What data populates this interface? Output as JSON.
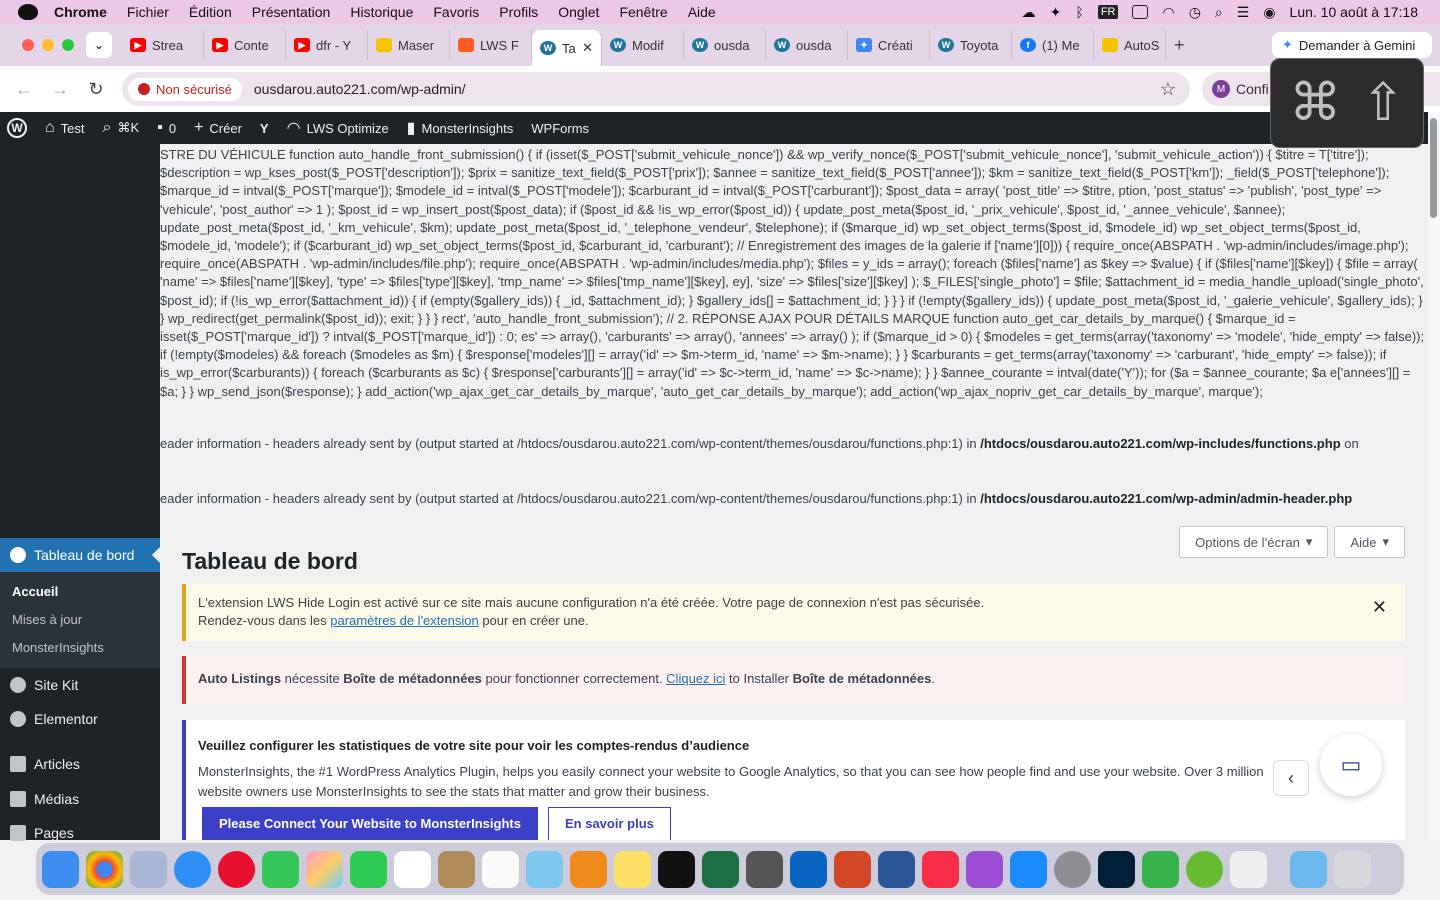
{
  "mac_menu": {
    "app": "Chrome",
    "items": [
      "Fichier",
      "Édition",
      "Présentation",
      "Historique",
      "Favoris",
      "Profils",
      "Onglet",
      "Fenêtre",
      "Aide"
    ],
    "datetime": "Lun. 10 août à 17:18",
    "kbd": "FR"
  },
  "tabs": [
    {
      "label": "Strea",
      "icon": "youtube",
      "color": "#ff0000"
    },
    {
      "label": "Conte",
      "icon": "youtube",
      "color": "#ff0000"
    },
    {
      "label": "dfr - Y",
      "icon": "youtube",
      "color": "#ff0000"
    },
    {
      "label": "Maser",
      "icon": "lws",
      "color": "#f5c400"
    },
    {
      "label": "LWS F",
      "icon": "lws",
      "color": "#ff5a1f"
    },
    {
      "label": "Ta",
      "icon": "wordpress",
      "color": "#21759b",
      "active": true
    },
    {
      "label": "Modif",
      "icon": "wordpress",
      "color": "#21759b"
    },
    {
      "label": "ousda",
      "icon": "wordpress",
      "color": "#21759b"
    },
    {
      "label": "ousda",
      "icon": "wordpress",
      "color": "#21759b"
    },
    {
      "label": "Créati",
      "icon": "gemini",
      "color": "#4285f4"
    },
    {
      "label": "Toyota",
      "icon": "wordpress",
      "color": "#21759b"
    },
    {
      "label": "(1) Me",
      "icon": "facebook",
      "color": "#1877f2"
    },
    {
      "label": "AutoS",
      "icon": "lws",
      "color": "#f5c400"
    }
  ],
  "gemini_button": "Demander à Gemini",
  "address": {
    "security": "Non sécurisé",
    "url": "ousdarou.auto221.com/wp-admin/",
    "profile": "Confi",
    "profile_initial": "M"
  },
  "shortcut_overlay": {
    "cmd": "⌘",
    "shift": "⇧"
  },
  "admin_bar": {
    "site": "Test",
    "search": "⌘K",
    "comments": "0",
    "create": "Créer",
    "lws": "LWS Optimize",
    "monster": "MonsterInsights",
    "wpforms": "WPForms"
  },
  "error_text": "STRE DU VÉHICULE function auto_handle_front_submission() { if (isset($_POST['submit_vehicule_nonce']) && wp_verify_nonce($_POST['submit_vehicule_nonce'], 'submit_vehicule_action')) { $titre = T['titre']); $description = wp_kses_post($_POST['description']); $prix = sanitize_text_field($_POST['prix']); $annee = sanitize_text_field($_POST['annee']); $km = sanitize_text_field($_POST['km']); _field($_POST['telephone']); $marque_id = intval($_POST['marque']); $modele_id = intval($_POST['modele']); $carburant_id = intval($_POST['carburant']); $post_data = array( 'post_title' => $titre, ption, 'post_status' => 'publish', 'post_type' => 'vehicule', 'post_author' => 1 ); $post_id = wp_insert_post($post_data); if ($post_id && !is_wp_error($post_id)) { update_post_meta($post_id, '_prix_vehicule', $post_id, '_annee_vehicule', $annee); update_post_meta($post_id, '_km_vehicule', $km); update_post_meta($post_id, '_telephone_vendeur', $telephone); if ($marque_id) wp_set_object_terms($post_id, $modele_id) wp_set_object_terms($post_id, $modele_id, 'modele'); if ($carburant_id) wp_set_object_terms($post_id, $carburant_id, 'carburant'); // Enregistrement des images de la galerie if ['name'][0])) { require_once(ABSPATH . 'wp-admin/includes/image.php'); require_once(ABSPATH . 'wp-admin/includes/file.php'); require_once(ABSPATH . 'wp-admin/includes/media.php'); $files = y_ids = array(); foreach ($files['name'] as $key => $value) { if ($files['name'][$key]) { $file = array( 'name' => $files['name'][$key], 'type' => $files['type'][$key], 'tmp_name' => $files['tmp_name'][$key], ey], 'size' => $files['size'][$key] ); $_FILES['single_photo'] = $file; $attachment_id = media_handle_upload('single_photo', $post_id); if (!is_wp_error($attachment_id)) { if (empty($gallery_ids)) { _id, $attachment_id); } $gallery_ids[] = $attachment_id; } } } if (!empty($gallery_ids)) { update_post_meta($post_id, '_galerie_vehicule', $gallery_ids); } } wp_redirect(get_permalink($post_id)); exit; } } } rect', 'auto_handle_front_submission'); // 2. RÉPONSE AJAX POUR DÉTAILS MARQUE function auto_get_car_details_by_marque() { $marque_id = isset($_POST['marque_id']) ? intval($_POST['marque_id']) : 0; es' => array(), 'carburants' => array(), 'annees' => array() ); if ($marque_id > 0) { $modeles = get_terms(array('taxonomy' => 'modele', 'hide_empty' => false)); if (!empty($modeles) && foreach ($modeles as $m) { $response['modeles'][] = array('id' => $m->term_id, 'name' => $m->name); } } $carburants = get_terms(array('taxonomy' => 'carburant', 'hide_empty' => false)); if is_wp_error($carburants)) { foreach ($carburants as $c) { $response['carburants'][] = array('id' => $c->term_id, 'name' => $c->name); } } $annee_courante = intval(date('Y')); for ($a = $annee_courante; $a e['annees'][] = $a; } } wp_send_json($response); } add_action('wp_ajax_get_car_details_by_marque', 'auto_get_car_details_by_marque'); add_action('wp_ajax_nopriv_get_car_details_by_marque', marque');",
  "warnings": [
    {
      "prefix": "eader information - headers already sent by (output started at /htdocs/ousdarou.auto221.com/wp-content/themes/ousdarou/functions.php:1) in ",
      "file": "/htdocs/ousdarou.auto221.com/wp-includes/functions.php",
      "suffix": " on"
    },
    {
      "prefix": "eader information - headers already sent by (output started at /htdocs/ousdarou.auto221.com/wp-content/themes/ousdarou/functions.php:1) in ",
      "file": "/htdocs/ousdarou.auto221.com/wp-admin/admin-header.php",
      "suffix": ""
    }
  ],
  "screen_options": "Options de l’écran",
  "help": "Aide",
  "page_title": "Tableau de bord",
  "notice_lws": {
    "line1": "L'extension LWS Hide Login est activé sur ce site mais aucune configuration n'a été créée. Votre page de connexion n'est pas sécurisée.",
    "line2_pre": "Rendez-vous dans les ",
    "link": "paramètres de l'extension",
    "line2_post": " pour en créer une."
  },
  "notice_auto": {
    "b1": "Auto Listings",
    "t1": " nécessite ",
    "b2": "Boîte de métadonnées",
    "t2": " pour fonctionner correctement. ",
    "link": "Cliquez ici",
    "t3": " to Installer ",
    "b3": "Boîte de métadonnées",
    "t4": "."
  },
  "notice_monster": {
    "title": "Veuillez configurer les statistiques de votre site pour voir les comptes-rendus d’audience",
    "body": "MonsterInsights, the #1 WordPress Analytics Plugin, helps you easily connect your website to Google Analytics, so that you can see how people find and use your website. Over 3 million website owners use MonsterInsights to see the stats that matter and grow their business.",
    "primary": "Please Connect Your Website to MonsterInsights",
    "secondary": "En savoir plus"
  },
  "sidebar": {
    "active": "Tableau de bord",
    "sub": [
      "Accueil",
      "Mises à jour",
      "MonsterInsights"
    ],
    "items": [
      "Site Kit",
      "Elementor",
      "Articles",
      "Médias",
      "Pages"
    ]
  }
}
